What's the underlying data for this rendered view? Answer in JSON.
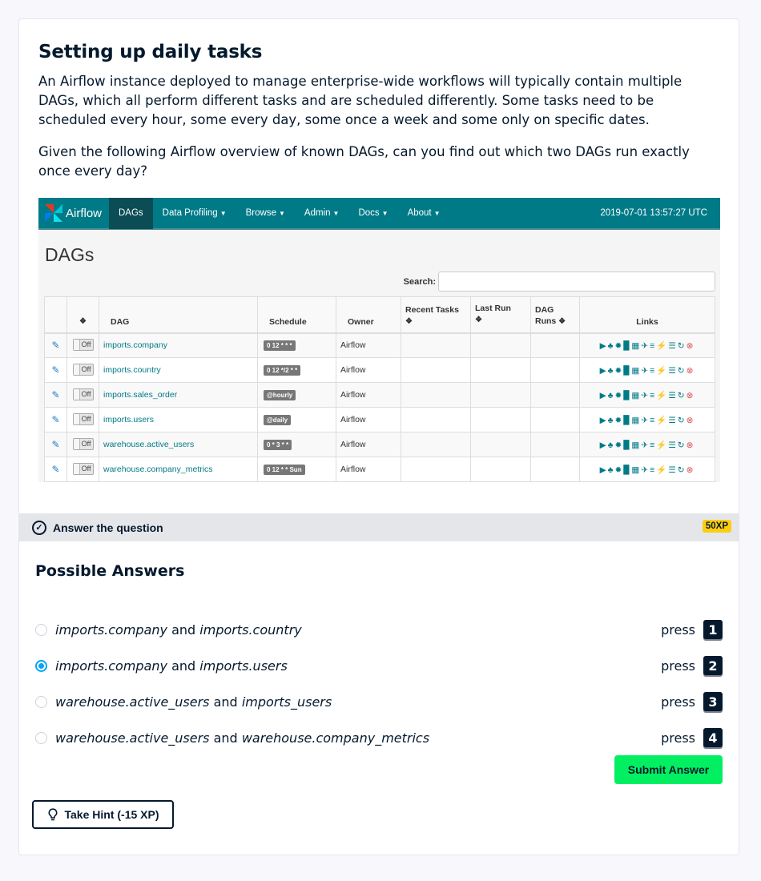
{
  "exercise": {
    "title": "Setting up daily tasks",
    "paragraphs": [
      "An Airflow instance deployed to manage enterprise-wide workflows will typically contain multiple DAGs, which all perform different tasks and are scheduled differently. Some tasks need to be scheduled every hour, some every day, some once a week and some only on specific dates.",
      "Given the following Airflow overview of known DAGs, can you find out which two DAGs run exactly once every day?"
    ]
  },
  "airflow": {
    "logo_text": "Airflow",
    "nav": [
      {
        "label": "DAGs",
        "dropdown": false,
        "active": true
      },
      {
        "label": "Data Profiling",
        "dropdown": true
      },
      {
        "label": "Browse",
        "dropdown": true
      },
      {
        "label": "Admin",
        "dropdown": true
      },
      {
        "label": "Docs",
        "dropdown": true
      },
      {
        "label": "About",
        "dropdown": true
      }
    ],
    "timestamp": "2019-07-01 13:57:27 UTC",
    "heading": "DAGs",
    "search_label": "Search:",
    "columns": [
      "DAG",
      "Schedule",
      "Owner",
      "Recent Tasks",
      "Last Run",
      "DAG Runs",
      "Links"
    ],
    "toggle_label": "Off",
    "rows": [
      {
        "dag": "imports.company",
        "schedule": "0 12 * * *",
        "owner": "Airflow"
      },
      {
        "dag": "imports.country",
        "schedule": "0 12 */2 * *",
        "owner": "Airflow"
      },
      {
        "dag": "imports.sales_order",
        "schedule": "@hourly",
        "owner": "Airflow"
      },
      {
        "dag": "imports.users",
        "schedule": "@daily",
        "owner": "Airflow"
      },
      {
        "dag": "warehouse.active_users",
        "schedule": "0 * 3 * *",
        "owner": "Airflow"
      },
      {
        "dag": "warehouse.company_metrics",
        "schedule": "0 12 * * Sun",
        "owner": "Airflow"
      }
    ],
    "link_icons": [
      "play-circle-icon",
      "tree-icon",
      "gear-icon",
      "bar-chart-icon",
      "tasks-icon",
      "plane-icon",
      "align-left-icon",
      "bolt-icon",
      "list-icon",
      "refresh-icon",
      "delete-icon"
    ]
  },
  "answer_bar": {
    "label": "Answer the question",
    "xp": "50XP"
  },
  "answers_heading": "Possible Answers",
  "answers": [
    {
      "a": "imports.company",
      "join": "and",
      "b": "imports.country",
      "key": "1",
      "selected": false
    },
    {
      "a": "imports.company",
      "join": "and",
      "b": "imports.users",
      "key": "2",
      "selected": true
    },
    {
      "a": "warehouse.active_users",
      "join": "and",
      "b": "imports_users",
      "key": "3",
      "selected": false
    },
    {
      "a": "warehouse.active_users",
      "join": "and",
      "b": "warehouse.company_metrics",
      "key": "4",
      "selected": false
    }
  ],
  "press_label": "press",
  "submit_label": "Submit Answer",
  "hint_label": "Take Hint (-15 XP)",
  "colors": {
    "submit": "#03ef62",
    "xp_badge": "#fcce0d",
    "airflow_nav": "#007a87",
    "radio_selected": "#03a6f2"
  }
}
